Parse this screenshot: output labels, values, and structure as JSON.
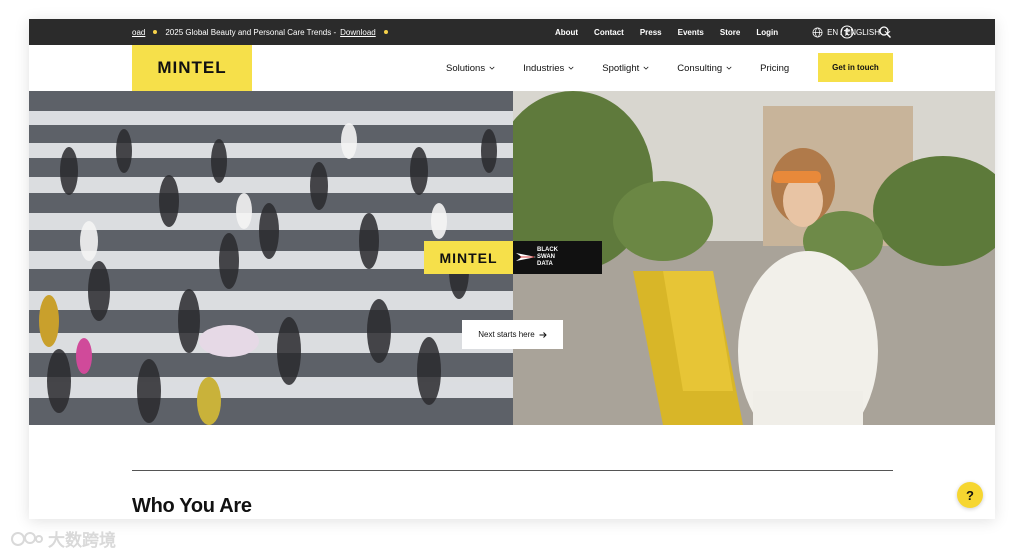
{
  "topbar": {
    "ticker_prefix": "oad",
    "ticker_text": "2025 Global Beauty and Personal Care Trends -",
    "ticker_link": "Download",
    "links": [
      "About",
      "Contact",
      "Press",
      "Events",
      "Store",
      "Login"
    ],
    "language": "EN / ENGLISH",
    "icons": [
      "globe-icon",
      "accessibility-icon",
      "search-icon"
    ]
  },
  "nav": {
    "logo": "MINTEL",
    "items": [
      {
        "label": "Solutions",
        "dropdown": true
      },
      {
        "label": "Industries",
        "dropdown": true
      },
      {
        "label": "Spotlight",
        "dropdown": true
      },
      {
        "label": "Consulting",
        "dropdown": true
      },
      {
        "label": "Pricing",
        "dropdown": false
      }
    ],
    "cta": "Get in touch"
  },
  "hero": {
    "badge_mintel": "MINTEL",
    "badge_partner_line1": "BLACK",
    "badge_partner_line2": "SWAN",
    "badge_partner_line3": "DATA",
    "button": "Next starts here"
  },
  "section": {
    "heading": "Who You Are"
  },
  "help_icon": "?",
  "watermark": "大数跨境",
  "colors": {
    "accent_yellow": "#f6e04a",
    "topbar_bg": "#2b2b2b",
    "text": "#111111"
  }
}
